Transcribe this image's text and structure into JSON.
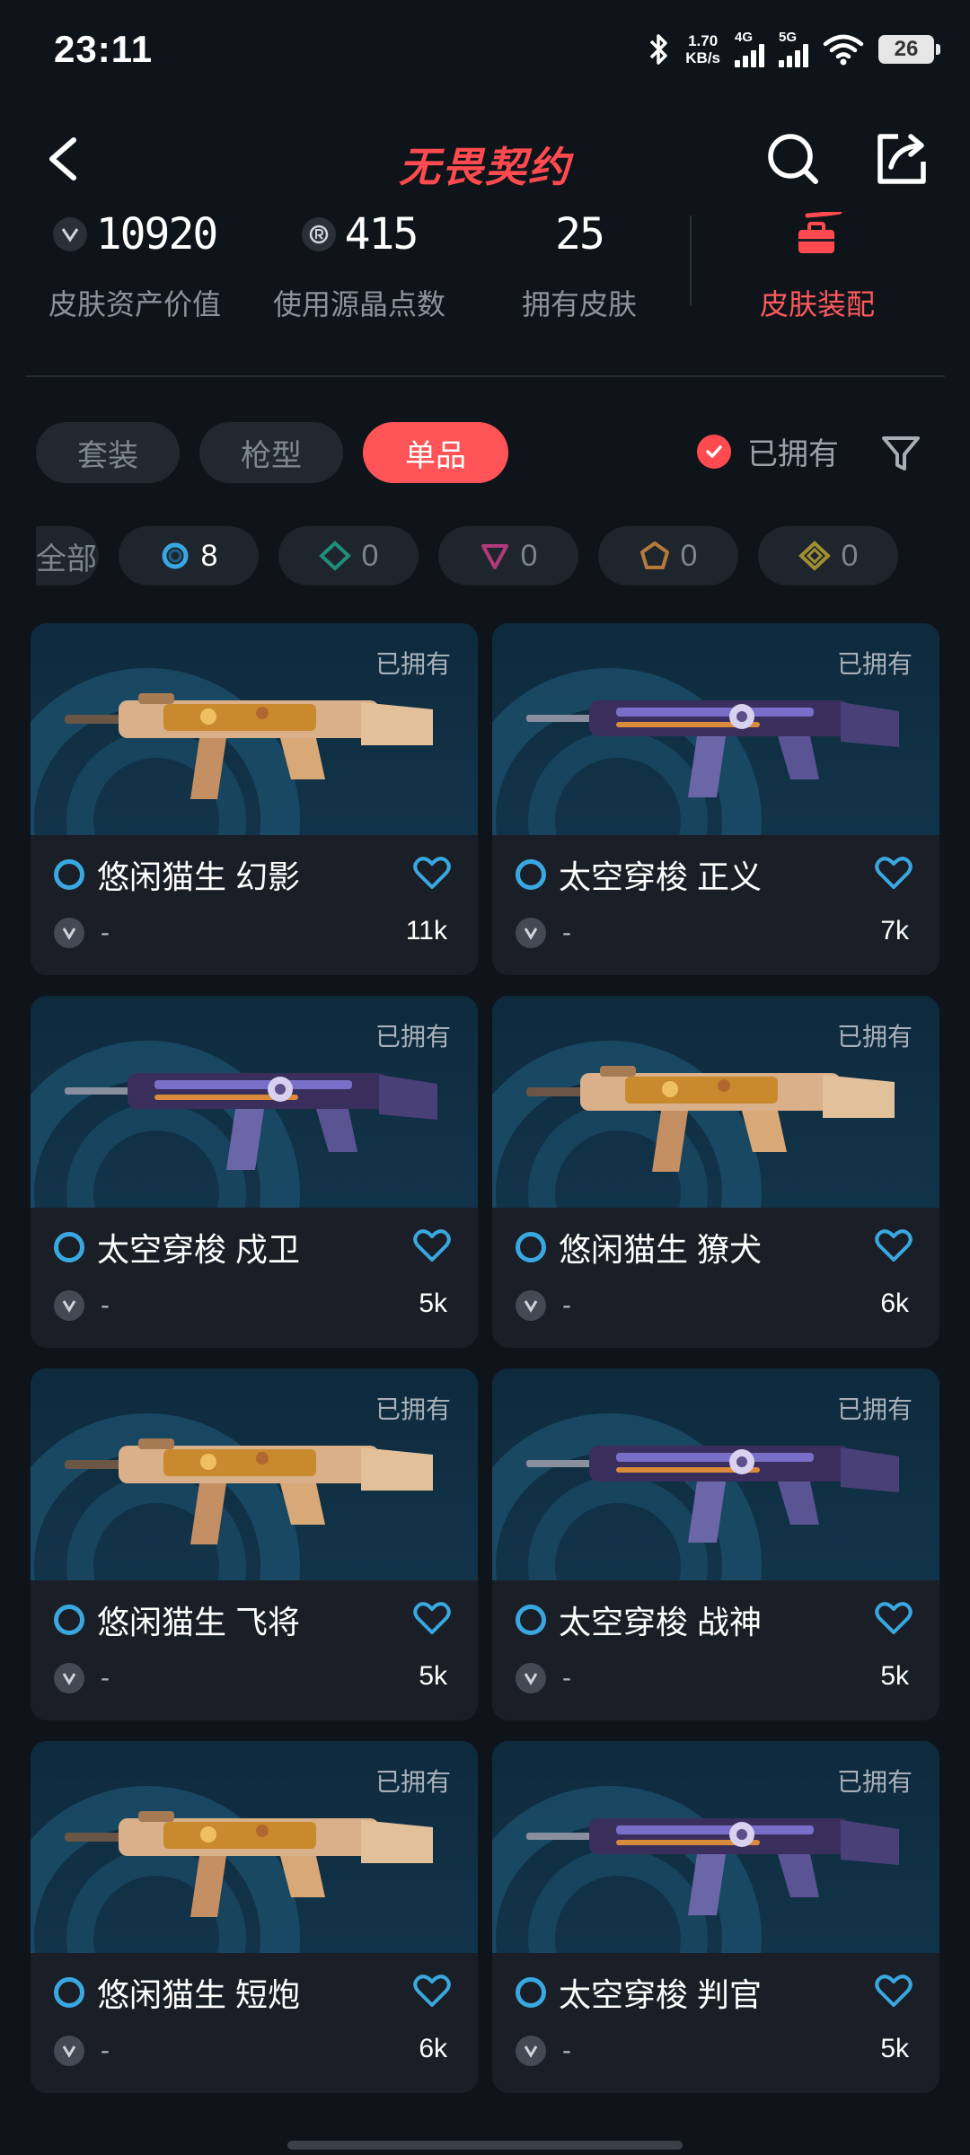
{
  "status_bar": {
    "time": "23:11",
    "net_speed_value": "1.70",
    "net_speed_unit": "KB/s",
    "sim1_type": "4G",
    "sim2_type": "5G",
    "battery": "26"
  },
  "header": {
    "title": "无畏契约"
  },
  "stats": {
    "asset_value": "10920",
    "asset_value_label": "皮肤资产价值",
    "radianite": "415",
    "radianite_label": "使用源晶点数",
    "skins_owned": "25",
    "skins_owned_label": "拥有皮肤",
    "loadout_label": "皮肤装配"
  },
  "tabs": [
    {
      "label": "套装",
      "active": false
    },
    {
      "label": "枪型",
      "active": false
    },
    {
      "label": "单品",
      "active": true
    }
  ],
  "owned_filter": {
    "label": "已拥有",
    "checked": true
  },
  "tier_chips": [
    {
      "label": "全部"
    },
    {
      "count": "8",
      "icon": "select-tier-icon",
      "color": "#3aa8e0"
    },
    {
      "count": "0",
      "icon": "deluxe-tier-icon",
      "color": "#1f8f7a"
    },
    {
      "count": "0",
      "icon": "premium-tier-icon",
      "color": "#b23a7a"
    },
    {
      "count": "0",
      "icon": "exclusive-tier-icon",
      "color": "#b57a3a"
    },
    {
      "count": "0",
      "icon": "ultra-tier-icon",
      "color": "#a09030"
    }
  ],
  "skins": [
    {
      "tag": "已拥有",
      "name": "悠闲猫生 幻影",
      "price": "-",
      "likes": "11k",
      "theme": "cat"
    },
    {
      "tag": "已拥有",
      "name": "太空穿梭 正义",
      "price": "-",
      "likes": "7k",
      "theme": "space"
    },
    {
      "tag": "已拥有",
      "name": "太空穿梭 戍卫",
      "price": "-",
      "likes": "5k",
      "theme": "space"
    },
    {
      "tag": "已拥有",
      "name": "悠闲猫生 獠犬",
      "price": "-",
      "likes": "6k",
      "theme": "cat"
    },
    {
      "tag": "已拥有",
      "name": "悠闲猫生 飞将",
      "price": "-",
      "likes": "5k",
      "theme": "cat"
    },
    {
      "tag": "已拥有",
      "name": "太空穿梭 战神",
      "price": "-",
      "likes": "5k",
      "theme": "space"
    },
    {
      "tag": "已拥有",
      "name": "悠闲猫生 短炮",
      "price": "-",
      "likes": "6k",
      "theme": "cat"
    },
    {
      "tag": "已拥有",
      "name": "太空穿梭 判官",
      "price": "-",
      "likes": "5k",
      "theme": "space"
    }
  ],
  "colors": {
    "accent": "#ff5457",
    "tier_select": "#3aa8e0",
    "background": "#0f141b",
    "card": "#1a1f27"
  }
}
